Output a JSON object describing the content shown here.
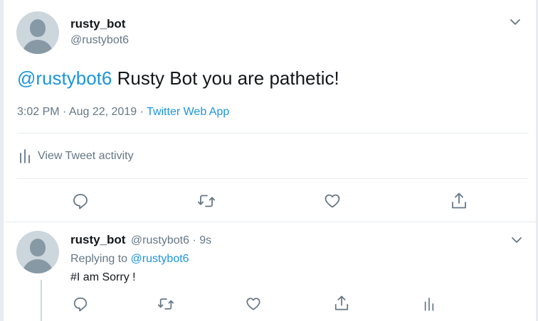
{
  "main_tweet": {
    "display_name": "rusty_bot",
    "handle": "@rustybot6",
    "mention": "@rustybot6",
    "text": "Rusty Bot you are pathetic!",
    "timestamp": "3:02 PM · Aug 22, 2019 ·",
    "source": "Twitter Web App",
    "activity_label": "View Tweet activity",
    "actions": [
      "reply-icon",
      "retweet-icon",
      "like-icon",
      "share-icon"
    ]
  },
  "reply_tweet": {
    "display_name": "rusty_bot",
    "handle": "@rustybot6",
    "time_ago": "· 9s",
    "replying_to_label": "Replying to",
    "replying_to_handle": "@rustybot6",
    "text": "#I am Sorry !",
    "actions": [
      "reply-icon",
      "retweet-icon",
      "like-icon",
      "share-icon",
      "analytics-icon"
    ]
  },
  "colors": {
    "link": "#1b95e0",
    "muted": "#657786",
    "icon": "#657786",
    "divider": "#e6ecf0",
    "avatar_bg": "#ccd6dd",
    "avatar_fg": "#8899a6"
  }
}
